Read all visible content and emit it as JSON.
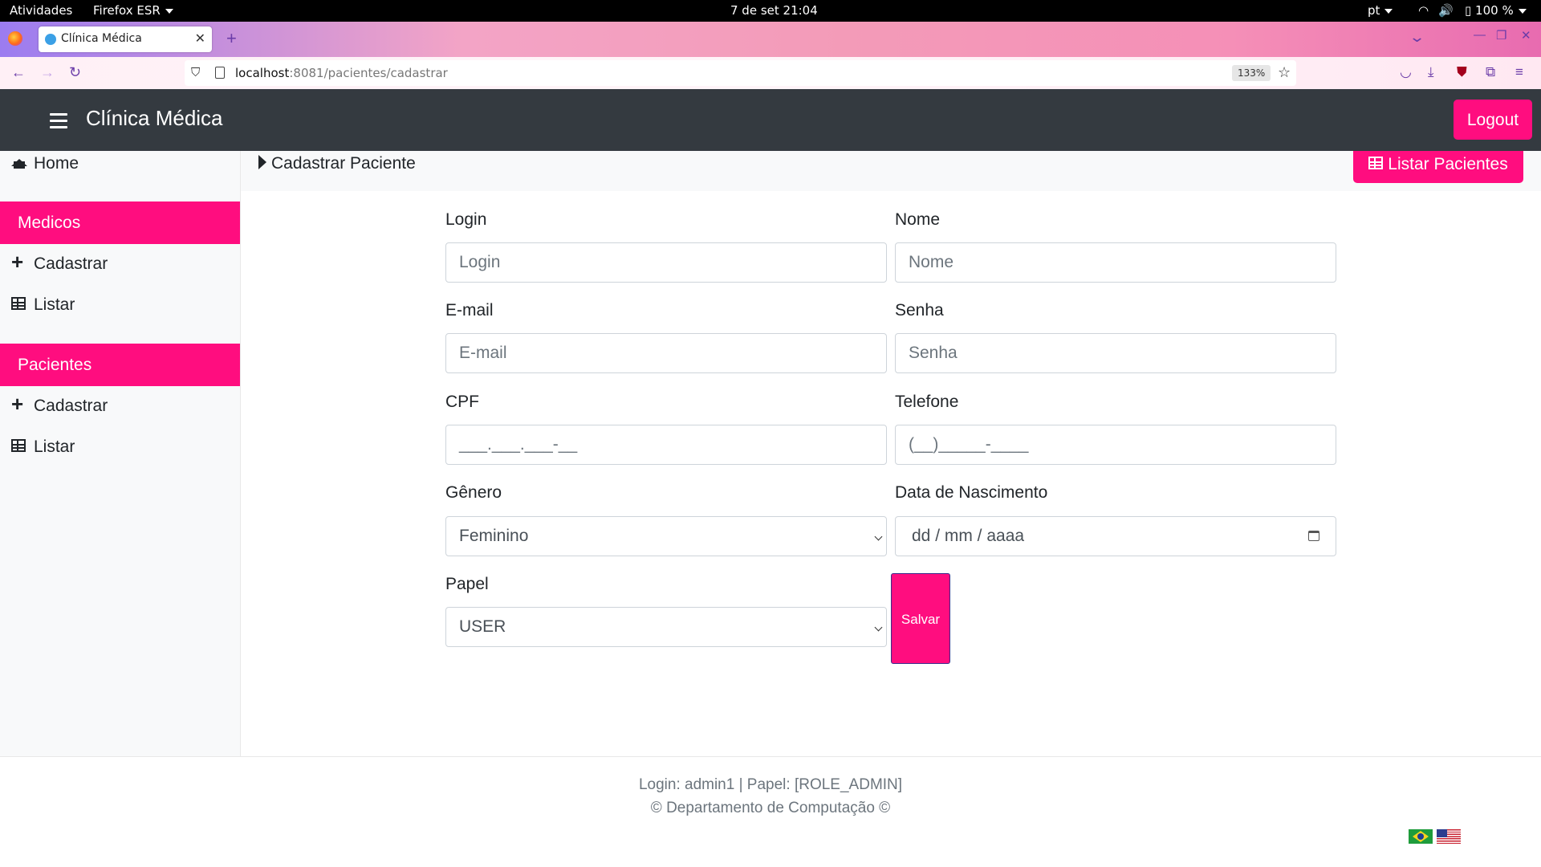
{
  "system": {
    "activities": "Atividades",
    "app_menu": "Firefox ESR",
    "clock": "7 de set  21:04",
    "language": "pt",
    "battery": "100 %"
  },
  "browser": {
    "tab_title": "Clínica Médica",
    "url_host": "localhost",
    "url_path": ":8081/pacientes/cadastrar",
    "zoom": "133%"
  },
  "header": {
    "brand": "Clínica Médica",
    "logout_label": "Logout"
  },
  "sidebar": {
    "home_label": "Home",
    "sections": [
      {
        "title": "Medicos",
        "items": [
          {
            "label": "Cadastrar"
          },
          {
            "label": "Listar"
          }
        ]
      },
      {
        "title": "Pacientes",
        "items": [
          {
            "label": "Cadastrar"
          },
          {
            "label": "Listar"
          }
        ]
      }
    ]
  },
  "page": {
    "breadcrumb": "Cadastrar Paciente",
    "list_button": "Listar Pacientes"
  },
  "form": {
    "login": {
      "label": "Login",
      "placeholder": "Login"
    },
    "nome": {
      "label": "Nome",
      "placeholder": "Nome"
    },
    "email": {
      "label": "E-mail",
      "placeholder": "E-mail"
    },
    "senha": {
      "label": "Senha",
      "placeholder": "Senha"
    },
    "cpf": {
      "label": "CPF",
      "placeholder": "___.___.___-__"
    },
    "telefone": {
      "label": "Telefone",
      "placeholder": "(__)_____-____"
    },
    "genero": {
      "label": "Gênero",
      "value": "Feminino"
    },
    "nascimento": {
      "label": "Data de Nascimento",
      "placeholder": "dd / mm / aaaa"
    },
    "papel": {
      "label": "Papel",
      "value": "USER"
    },
    "submit_label": "Salvar"
  },
  "footer": {
    "login_info": "Login: admin1 | Papel: [ROLE_ADMIN]",
    "copyright": "© Departamento de Computação ©"
  },
  "colors": {
    "accent": "#ff0d7f",
    "header_bg": "#343a40",
    "sidebar_bg": "#f8f9fa"
  }
}
